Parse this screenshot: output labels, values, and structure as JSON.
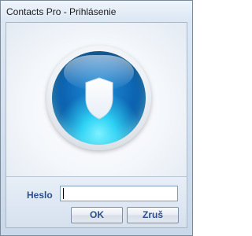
{
  "window": {
    "title": "Contacts Pro - Prihlásenie"
  },
  "hero": {
    "icon": "shield-icon",
    "colors": {
      "orb_dark": "#063a7a",
      "orb_mid": "#0b5fae",
      "orb_glow": "#2ed2f5"
    }
  },
  "login": {
    "password_label": "Heslo",
    "password_value": "",
    "ok_label": "OK",
    "cancel_label": "Zruš"
  },
  "colors": {
    "accent_text": "#2b4f8c",
    "input_border": "#7f9db9"
  }
}
